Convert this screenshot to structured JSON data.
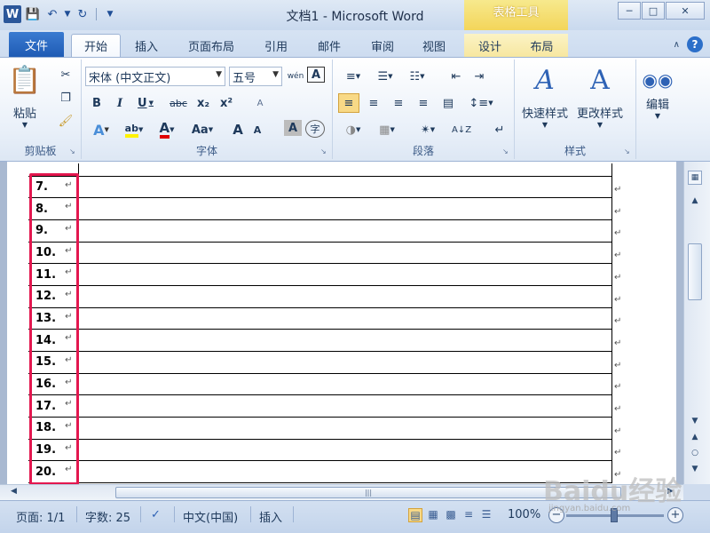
{
  "app": {
    "title": "文档1 - Microsoft Word",
    "logo_letter": "W",
    "context_tab_header": "表格工具"
  },
  "tabs": [
    "文件",
    "开始",
    "插入",
    "页面布局",
    "引用",
    "邮件",
    "审阅",
    "视图",
    "设计",
    "布局"
  ],
  "ribbon": {
    "clipboard": {
      "label": "剪贴板",
      "paste": "粘贴"
    },
    "font": {
      "label": "字体",
      "font_name": "宋体 (中文正文)",
      "font_size": "五号",
      "phonetic": "wén",
      "char_border": "A",
      "bold": "B",
      "italic": "I",
      "underline": "U",
      "strike": "abc",
      "subscript": "x₂",
      "superscript": "x²",
      "clear_format": "A",
      "text_effects": "A",
      "highlight": "ab",
      "font_color": "A",
      "change_case": "Aa",
      "grow": "A",
      "shrink": "A",
      "char_shading": "A",
      "enclose": "字"
    },
    "paragraph": {
      "label": "段落"
    },
    "styles": {
      "label": "样式",
      "quick_styles": "快速样式",
      "change_styles": "更改样式"
    },
    "editing": {
      "label": "编辑"
    }
  },
  "document": {
    "rows": [
      "7.",
      "8.",
      "9.",
      "10.",
      "11.",
      "12.",
      "13.",
      "14.",
      "15.",
      "16.",
      "17.",
      "18.",
      "19.",
      "20."
    ],
    "highlight_color": "#e3174f"
  },
  "statusbar": {
    "page": "页面: 1/1",
    "words": "字数: 25",
    "language": "中文(中国)",
    "mode": "插入",
    "zoom": "100%"
  },
  "watermark": {
    "text": "Baidu经验",
    "sub": "jingyan.baidu.com"
  }
}
